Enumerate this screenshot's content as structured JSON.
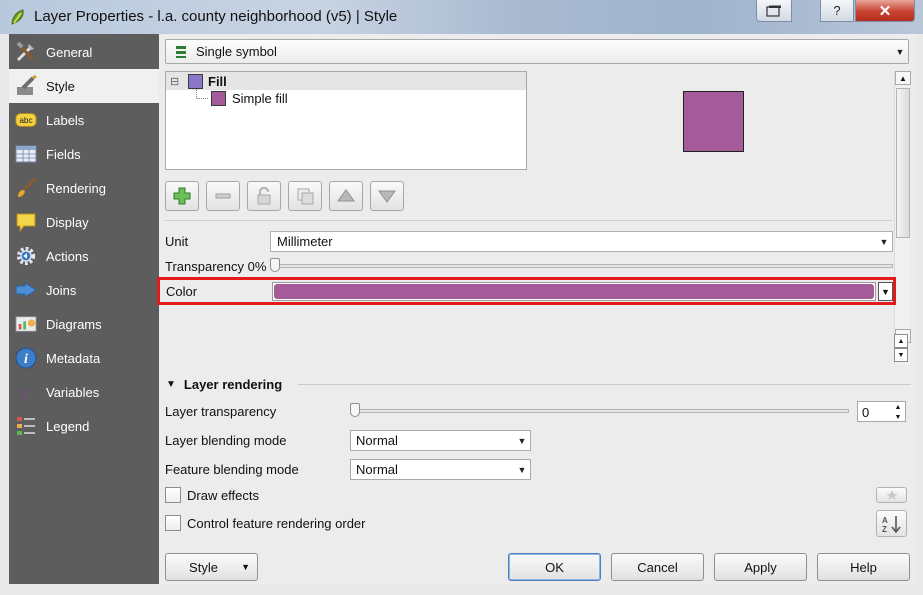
{
  "window": {
    "title": "Layer Properties - l.a. county neighborhood (v5) | Style",
    "help_label": "?",
    "close_label": "✕"
  },
  "sidebar": {
    "items": [
      {
        "label": "General",
        "icon": "wrench-hammer-icon"
      },
      {
        "label": "Style",
        "icon": "paintbrush-icon",
        "active": true
      },
      {
        "label": "Labels",
        "icon": "abc-label-icon"
      },
      {
        "label": "Fields",
        "icon": "table-icon"
      },
      {
        "label": "Rendering",
        "icon": "brush-icon"
      },
      {
        "label": "Display",
        "icon": "speech-bubble-icon"
      },
      {
        "label": "Actions",
        "icon": "gear-icon"
      },
      {
        "label": "Joins",
        "icon": "join-icon"
      },
      {
        "label": "Diagrams",
        "icon": "diagram-icon"
      },
      {
        "label": "Metadata",
        "icon": "info-icon"
      },
      {
        "label": "Variables",
        "icon": "epsilon-icon"
      },
      {
        "label": "Legend",
        "icon": "legend-icon"
      }
    ]
  },
  "style": {
    "renderer": "Single symbol",
    "tree": {
      "fill_label": "Fill",
      "fill_collapse": "⊟",
      "child_label": "Simple fill"
    },
    "symbol_color": "#a45b9a",
    "unit_label": "Unit",
    "unit_value": "Millimeter",
    "transparency_label": "Transparency 0%",
    "transparency_value": 0,
    "color_label": "Color",
    "color_value": "#a45b9a",
    "highlight_color": "#e11b1b"
  },
  "layer_rendering": {
    "header": "Layer rendering",
    "transparency_label": "Layer transparency",
    "transparency_value": "0",
    "blend_label": "Layer blending mode",
    "blend_value": "Normal",
    "feature_blend_label": "Feature blending mode",
    "feature_blend_value": "Normal",
    "draw_effects_label": "Draw effects",
    "order_label": "Control feature rendering order"
  },
  "buttons": {
    "style": "Style",
    "ok": "OK",
    "cancel": "Cancel",
    "apply": "Apply",
    "help": "Help"
  }
}
